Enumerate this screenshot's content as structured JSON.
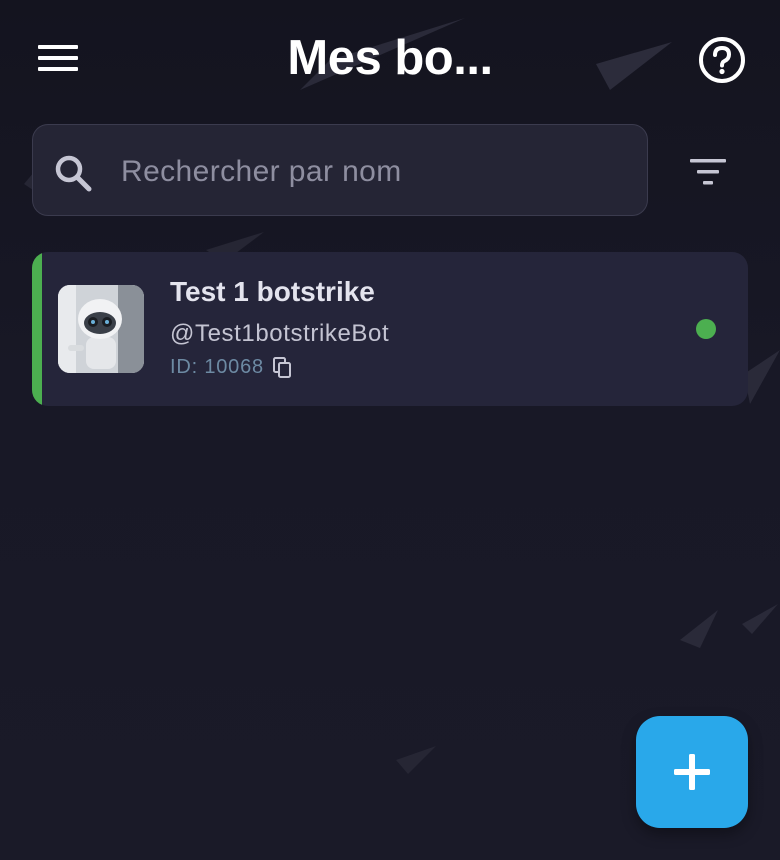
{
  "header": {
    "title": "Mes bo...",
    "menu_icon": "hamburger-menu-icon",
    "help_icon": "help-circle-icon"
  },
  "search": {
    "placeholder": "Rechercher par nom",
    "value": "",
    "search_icon": "search-icon",
    "filter_icon": "filter-list-icon"
  },
  "bots": [
    {
      "name": "Test 1 botstrike",
      "username": "@Test1botstrikeBot",
      "id_label": "ID: 10068",
      "status": "online",
      "status_color": "#4caf50",
      "copy_icon": "copy-icon",
      "avatar_icon": "robot-avatar"
    }
  ],
  "fab": {
    "icon": "plus-icon",
    "color": "#29a8ea"
  },
  "colors": {
    "background": "#181826",
    "card": "#25253a",
    "accent_online": "#4caf50",
    "fab": "#29a8ea",
    "id_text": "#6d8aa3"
  }
}
